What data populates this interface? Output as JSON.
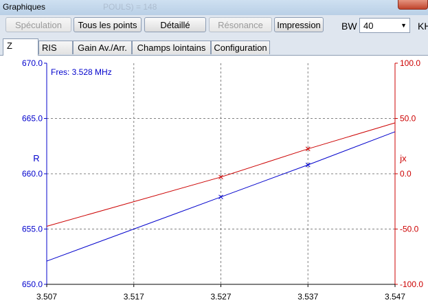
{
  "window": {
    "title": "Graphiques",
    "ghost_title": "POULS) = 148"
  },
  "toolbar": {
    "buttons": [
      {
        "label": "Spéculation",
        "enabled": false
      },
      {
        "label": "Tous les points",
        "enabled": true
      },
      {
        "label": "Détaillé",
        "enabled": true
      },
      {
        "label": "Résonance",
        "enabled": false
      },
      {
        "label": "Impression",
        "enabled": true
      }
    ],
    "bw_label": "BW",
    "bw_value": "40",
    "unit_fragment": "KH"
  },
  "tabs": [
    {
      "label": "Z",
      "active": true
    },
    {
      "label": "RIS",
      "active": false
    },
    {
      "label": "Gain Av./Arr.",
      "active": false
    },
    {
      "label": "Champs lointains",
      "active": false
    },
    {
      "label": "Configuration",
      "active": false
    }
  ],
  "colors": {
    "resistance": "#0000cc",
    "reactance": "#cc0000",
    "grid": "#808080"
  },
  "chart_data": {
    "type": "line",
    "annotation": "Fres: 3.528 MHz",
    "x_ticks": [
      "3.507",
      "3.517",
      "3.527",
      "3.537",
      "3.547"
    ],
    "xlim": [
      3.507,
      3.547
    ],
    "left_axis": {
      "label": "R",
      "ticks": [
        "670.0",
        "665.0",
        "660.0",
        "655.0",
        "650.0"
      ],
      "range": [
        650,
        670
      ]
    },
    "right_axis": {
      "label": "jx",
      "ticks": [
        "100.0",
        "50.0",
        "0.0",
        "-50.0",
        "-100.0"
      ],
      "range": [
        -100,
        100
      ]
    },
    "series": [
      {
        "name": "R",
        "axis": "left",
        "color": "#0000cc",
        "x": [
          3.507,
          3.527,
          3.537,
          3.547
        ],
        "y": [
          652.1,
          657.9,
          660.8,
          663.8
        ],
        "markers_x": [
          3.527,
          3.537
        ]
      },
      {
        "name": "jx",
        "axis": "right",
        "color": "#cc0000",
        "x": [
          3.507,
          3.527,
          3.537,
          3.547
        ],
        "y": [
          -47.5,
          -3.0,
          22.5,
          46.0
        ],
        "markers_x": [
          3.527,
          3.537
        ]
      }
    ]
  }
}
